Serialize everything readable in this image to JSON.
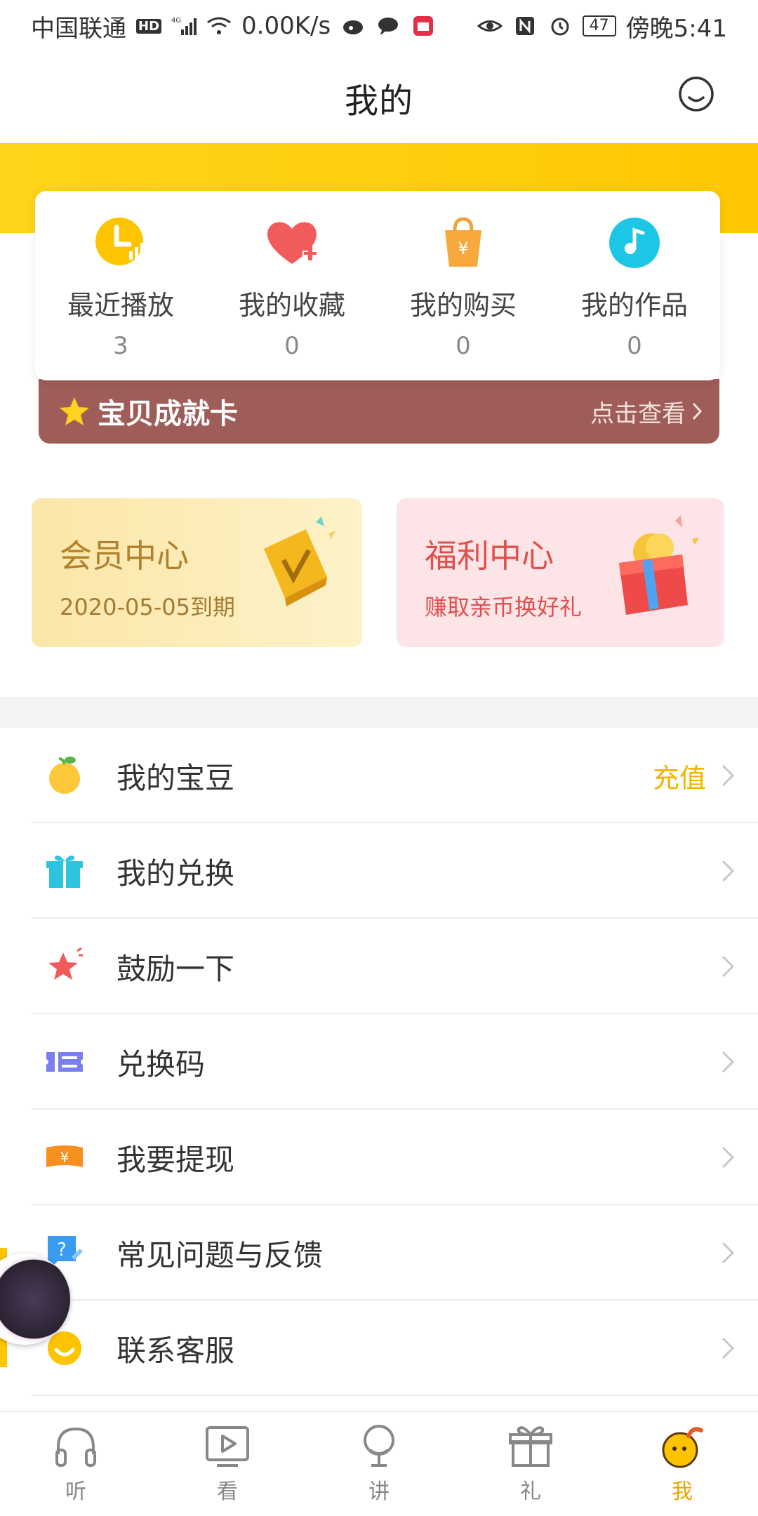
{
  "status_bar": {
    "carrier": "中国联通",
    "network": "4G",
    "speed": "0.00K/s",
    "battery": "47",
    "time": "傍晚5:41"
  },
  "header": {
    "title": "我的",
    "message_icon": "smile-chat-icon"
  },
  "stats": [
    {
      "label": "最近播放",
      "count": "3",
      "icon": "recent-play-icon"
    },
    {
      "label": "我的收藏",
      "count": "0",
      "icon": "heart-plus-icon"
    },
    {
      "label": "我的购买",
      "count": "0",
      "icon": "shopping-bag-icon"
    },
    {
      "label": "我的作品",
      "count": "0",
      "icon": "music-note-icon"
    }
  ],
  "achievement": {
    "title": "宝贝成就卡",
    "link": "点击查看"
  },
  "promos": {
    "vip": {
      "title": "会员中心",
      "subtitle": "2020-05-05到期"
    },
    "welfare": {
      "title": "福利中心",
      "subtitle": "赚取亲币换好礼"
    }
  },
  "menu": [
    {
      "label": "我的宝豆",
      "extra": "充值",
      "icon": "bean-icon"
    },
    {
      "label": "我的兑换",
      "icon": "gift-box-icon"
    },
    {
      "label": "鼓励一下",
      "icon": "star-icon"
    },
    {
      "label": "兑换码",
      "icon": "ticket-icon"
    },
    {
      "label": "我要提现",
      "icon": "cash-icon"
    },
    {
      "label": "常见问题与反馈",
      "icon": "question-icon"
    },
    {
      "label": "联系客服",
      "icon": "customer-service-icon"
    }
  ],
  "bottom_nav": [
    {
      "label": "听",
      "icon": "headphones-icon"
    },
    {
      "label": "看",
      "icon": "video-play-icon"
    },
    {
      "label": "讲",
      "icon": "microphone-icon"
    },
    {
      "label": "礼",
      "icon": "gift-icon"
    },
    {
      "label": "我",
      "icon": "mascot-icon",
      "active": true
    }
  ],
  "colors": {
    "accent": "#ffc800",
    "banner": "#9e5d58",
    "active_tab": "#e8a800"
  }
}
